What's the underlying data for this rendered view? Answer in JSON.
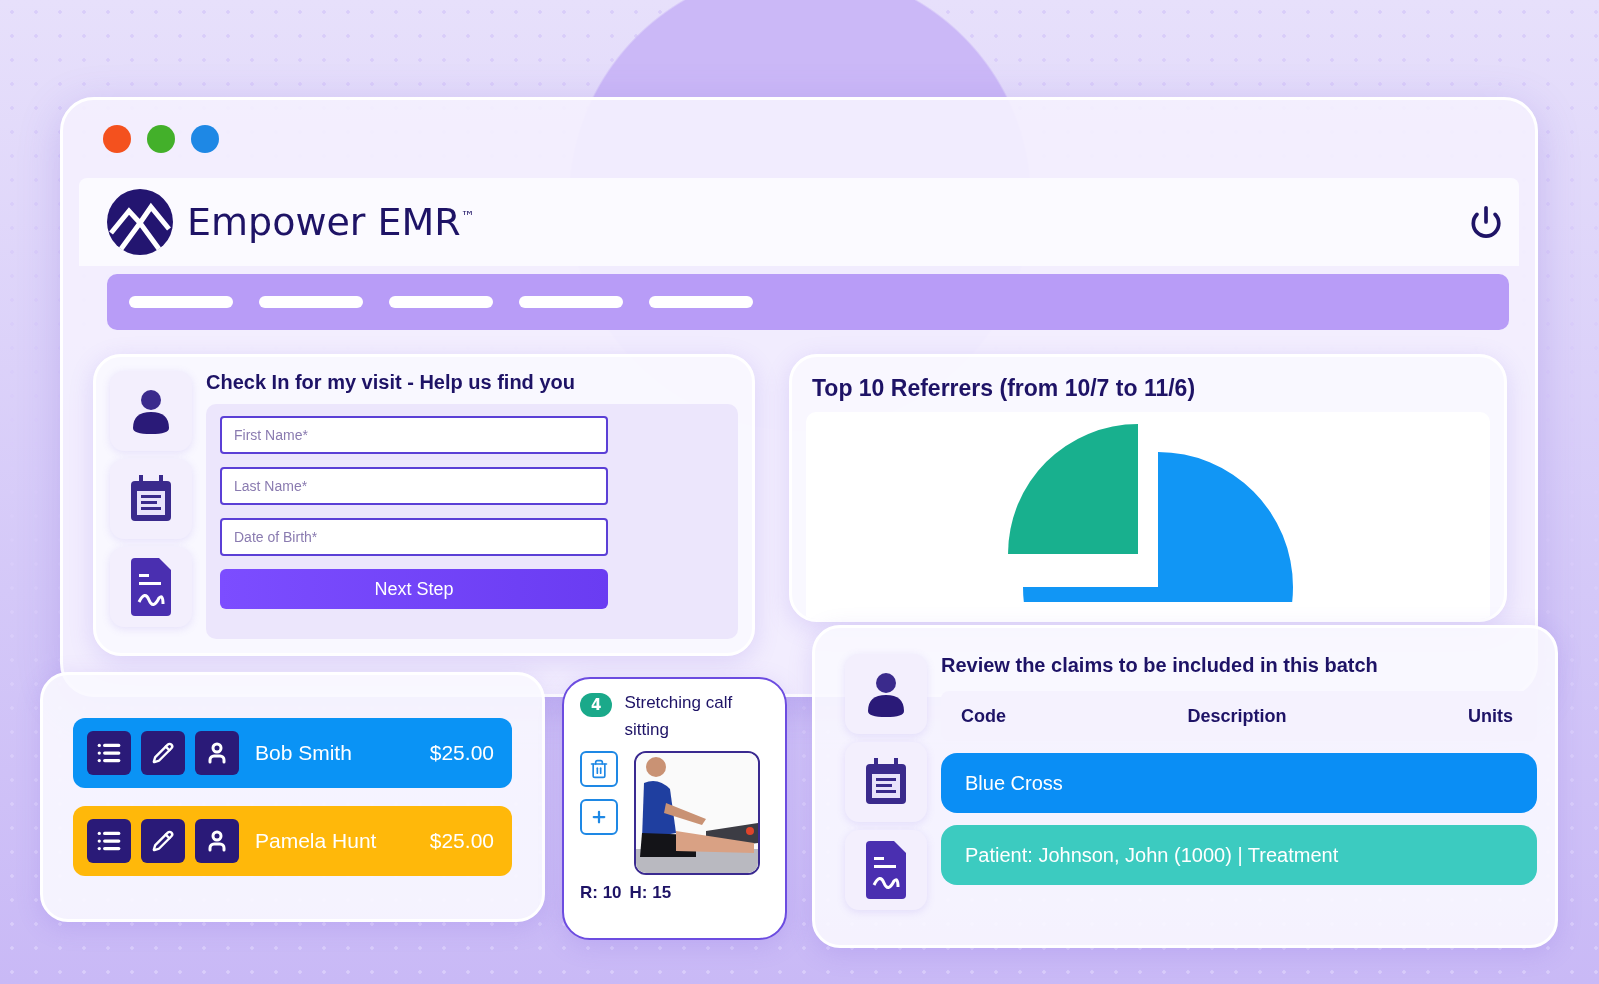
{
  "window": {
    "controls": [
      {
        "color": "#f4511e"
      },
      {
        "color": "#43b02a"
      },
      {
        "color": "#1e88e5"
      }
    ]
  },
  "app": {
    "title": "Empower EMR$^{™}$"
  },
  "checkin": {
    "title": "Check In for my visit - Help us find you",
    "fields": [
      {
        "placeholder": "First Name*"
      },
      {
        "placeholder": "Last Name*"
      },
      {
        "placeholder": "Date of Birth*"
      }
    ],
    "button": "Next Step"
  },
  "chart": {
    "title": "Top 10 Referrers (from 10/7 to 11/6)"
  },
  "patients": [
    {
      "name": "Bob Smith",
      "amount": "$25.00",
      "color": "#0a93f5"
    },
    {
      "name": "Pamela Hunt",
      "amount": "$25.00",
      "color": "#ffb80a"
    }
  ],
  "exercise": {
    "number": "4",
    "title": "Stretching calf sitting",
    "reps": "R: 10",
    "hold": "H: 15"
  },
  "claims": {
    "title": "Review the claims to be included in this batch",
    "columns": [
      "Code",
      "Description",
      "Units"
    ],
    "rows": [
      {
        "text": "Blue Cross",
        "color": "#0a8ef5"
      },
      {
        "text": "Patient: Johnson, John (1000) | Treatment",
        "color": "#3ccbc0"
      }
    ]
  }
}
